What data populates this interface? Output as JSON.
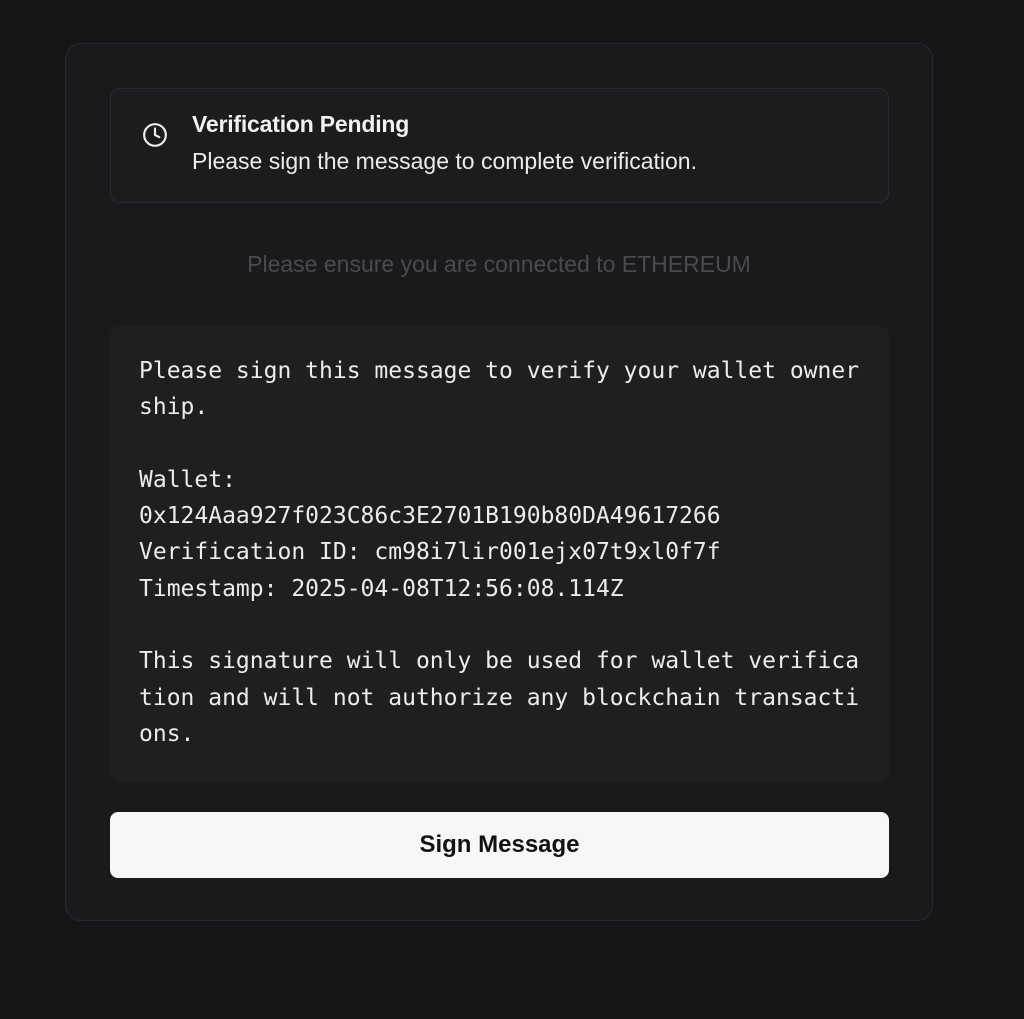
{
  "alert": {
    "icon": "clock-icon",
    "title": "Verification Pending",
    "description": "Please sign the message to complete verification."
  },
  "network_hint": "Please ensure you are connected to ETHEREUM",
  "message": {
    "line_1": "Please sign this message to verify your wallet ownership.",
    "wallet_label": "Wallet:",
    "wallet_address": "0x124Aaa927f023C86c3E2701B190b80DA49617266",
    "verification_id": "Verification ID: cm98i7lir001ejx07t9xl0f7f",
    "timestamp": "Timestamp: 2025-04-08T12:56:08.114Z",
    "disclaimer": "This signature will only be used for wallet verification and will not authorize any blockchain transactions."
  },
  "button": {
    "label": "Sign Message"
  },
  "colors": {
    "background": "#161618",
    "card": "#1a1a1d",
    "button": "#f7f7f7",
    "muted_text": "#4a4a4f"
  }
}
